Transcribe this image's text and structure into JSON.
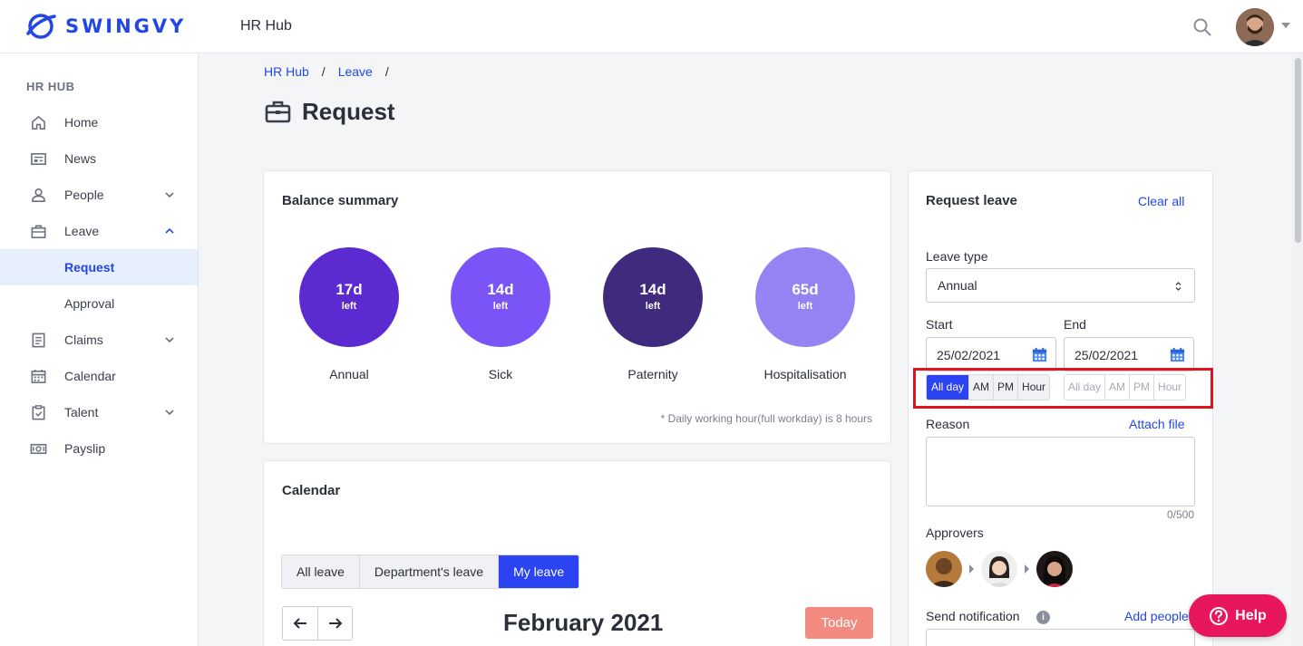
{
  "header": {
    "brand": "SWINGVY",
    "app_title": "HR Hub",
    "icons": {
      "search": "search-icon",
      "avatar": "user-avatar",
      "menu": "caret-down-icon"
    }
  },
  "sidebar": {
    "heading": "HR HUB",
    "items": [
      {
        "label": "Home",
        "icon": "home-icon"
      },
      {
        "label": "News",
        "icon": "newspaper-icon"
      },
      {
        "label": "People",
        "icon": "person-icon",
        "expandable": true
      },
      {
        "label": "Leave",
        "icon": "briefcase-icon",
        "expanded": true
      },
      {
        "label": "Request",
        "sub": true,
        "active": true
      },
      {
        "label": "Approval",
        "sub": true
      },
      {
        "label": "Claims",
        "icon": "receipt-icon",
        "expandable": true
      },
      {
        "label": "Calendar",
        "icon": "calendar-icon"
      },
      {
        "label": "Talent",
        "icon": "clipboard-icon",
        "expandable": true
      },
      {
        "label": "Payslip",
        "icon": "money-icon"
      }
    ]
  },
  "breadcrumb": {
    "items": [
      "HR Hub",
      "Leave"
    ],
    "separator": "/"
  },
  "page": {
    "title": "Request"
  },
  "balance": {
    "title": "Balance summary",
    "left_label": "left",
    "items": [
      {
        "days": "17d",
        "label": "Annual",
        "color": "#5b2bd1"
      },
      {
        "days": "14d",
        "label": "Sick",
        "color": "#7a54f7"
      },
      {
        "days": "14d",
        "label": "Paternity",
        "color": "#3f2a7e"
      },
      {
        "days": "65d",
        "label": "Hospitalisation",
        "color": "#9583f3"
      }
    ],
    "footnote": "* Daily working hour(full workday) is 8 hours"
  },
  "calendar": {
    "title": "Calendar",
    "filters": [
      "All leave",
      "Department's leave",
      "My leave"
    ],
    "active_filter": "My leave",
    "month": "February 2021",
    "today_label": "Today"
  },
  "request": {
    "title": "Request leave",
    "clear_all": "Clear all",
    "leave_type_label": "Leave type",
    "leave_type_value": "Annual",
    "start_label": "Start",
    "end_label": "End",
    "start_date": "25/02/2021",
    "end_date": "25/02/2021",
    "start_durations": [
      "All day",
      "AM",
      "PM",
      "Hour"
    ],
    "start_active": "All day",
    "end_durations": [
      "All day",
      "AM",
      "PM",
      "Hour"
    ],
    "reason_label": "Reason",
    "attach_file": "Attach file",
    "char_count": "0/500",
    "approvers_label": "Approvers",
    "send_notification_label": "Send notification",
    "add_people": "Add people"
  },
  "help": {
    "label": "Help"
  },
  "colors": {
    "accent": "#2346e6",
    "active_button": "#2b43f0",
    "today": "#f38a7f",
    "help": "#e8175d",
    "highlight": "#e0141e"
  }
}
